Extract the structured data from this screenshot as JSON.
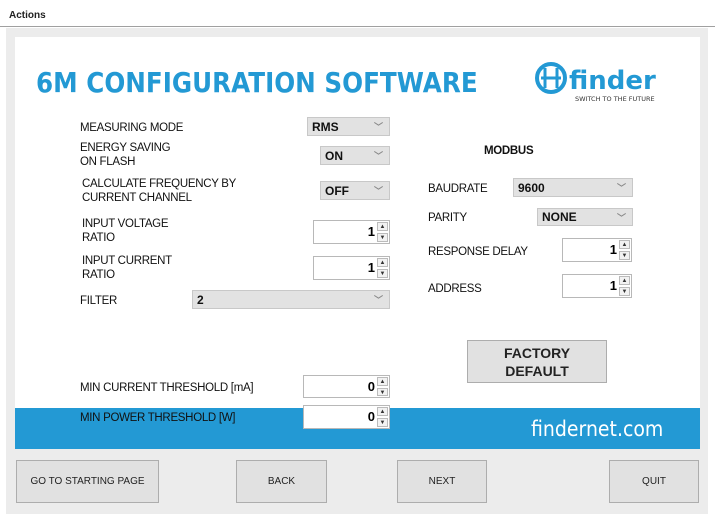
{
  "menu": {
    "actions": "Actions"
  },
  "header": {
    "title": "6M CONFIGURATION SOFTWARE",
    "logo_text": "finder",
    "logo_tagline": "SWITCH TO THE FUTURE"
  },
  "left": {
    "measuring_mode": {
      "label": "MEASURING MODE",
      "value": "RMS"
    },
    "energy_saving": {
      "label1": "ENERGY SAVING",
      "label2": "ON FLASH",
      "value": "ON"
    },
    "calc_freq": {
      "label1": "CALCULATE FREQUENCY BY",
      "label2": "CURRENT CHANNEL",
      "value": "OFF"
    },
    "input_voltage": {
      "label1": "INPUT VOLTAGE",
      "label2": "RATIO",
      "value": "1"
    },
    "input_current": {
      "label1": "INPUT CURRENT",
      "label2": "RATIO",
      "value": "1"
    },
    "filter": {
      "label": "FILTER",
      "value": "2"
    },
    "min_current": {
      "label": "MIN CURRENT THRESHOLD [mA]",
      "value": "0"
    },
    "min_power": {
      "label": "MIN POWER THRESHOLD [W]",
      "value": "0"
    }
  },
  "modbus": {
    "title": "MODBUS",
    "baudrate": {
      "label": "BAUDRATE",
      "value": "9600"
    },
    "parity": {
      "label": "PARITY",
      "value": "NONE"
    },
    "response_delay": {
      "label": "RESPONSE DELAY",
      "value": "1"
    },
    "address": {
      "label": "ADDRESS",
      "value": "1"
    },
    "factory_default1": "FACTORY",
    "factory_default2": "DEFAULT"
  },
  "footer": {
    "website": "findernet.com"
  },
  "nav": {
    "start": "GO TO STARTING PAGE",
    "back": "BACK",
    "next": "NEXT",
    "quit": "QUIT"
  },
  "colors": {
    "accent": "#2399d4"
  }
}
